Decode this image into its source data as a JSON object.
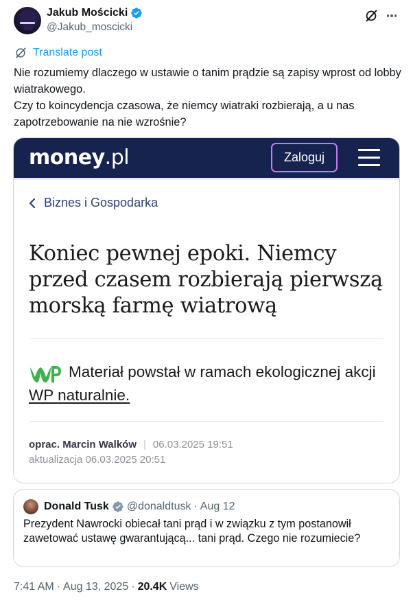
{
  "author": {
    "name": "Jakub Mościcki",
    "handle": "@Jakub_moscicki"
  },
  "translate_label": "Translate post",
  "tweet_lines": [
    "Nie rozumiemy dlaczego w ustawie o tanim prądzie są zapisy wprost od lobby wiatrakowego.",
    "Czy to koincydencja czasowa, że niemcy wiatraki rozbierają, a u nas zapotrzebowanie na nie wzrośnie?"
  ],
  "media": {
    "logo_bold": "money",
    "logo_dot": ".",
    "logo_tld": "pl",
    "login_label": "Zaloguj",
    "breadcrumb": "Biznes i Gospodarka",
    "headline": "Koniec pewnej epoki. Niemcy przed czasem rozbierają pierwszą morską farmę wiatrową",
    "eco_text_before": "Materiał powstał w ramach ekologicznej akcji ",
    "eco_link": "WP naturalnie.",
    "byline_prefix": "oprac.",
    "byline_author": "Marcin Walków",
    "byline_sep": "|",
    "byline_date": "06.03.2025 19:51",
    "updated": "aktualizacja 06.03.2025 20:51",
    "colors": {
      "header_bg": "#17234f",
      "login_border": "#c27ee6",
      "wp_green": "#3fb24e"
    }
  },
  "quote": {
    "name": "Donald Tusk",
    "handle": "@donaldtusk",
    "dot": "·",
    "date": "Aug 12",
    "text": "Prezydent Nawrocki obiecał tani prąd i w związku z tym postanowił zawetować ustawę gwarantującą... tani prąd. Czego nie rozumiecie?"
  },
  "meta": {
    "time": "7:41 AM",
    "dot1": "·",
    "date": "Aug 13, 2025",
    "dot2": "·",
    "views_count": "20.4K",
    "views_label": "Views"
  },
  "icons": {
    "verified": "verified-badge-icon",
    "grok": "grok-icon",
    "more": "more-icon",
    "translate": "translate-icon",
    "chevron": "chevron-left-icon",
    "burger": "hamburger-menu-icon",
    "wp": "wp-logo-icon"
  },
  "colors": {
    "accent": "#1d9bf0",
    "text": "#0f1419",
    "muted": "#536471",
    "border": "#cfd9de"
  }
}
